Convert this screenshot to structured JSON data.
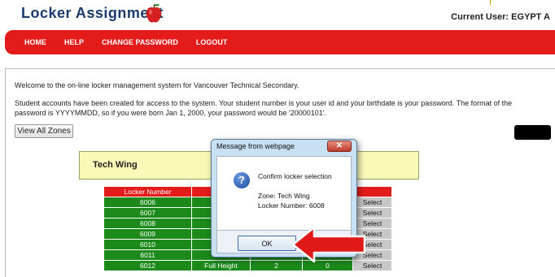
{
  "header": {
    "app_title": "Locker Assignment",
    "current_user": "Current User: EGYPT A"
  },
  "nav": {
    "items": [
      "HOME",
      "HELP",
      "CHANGE PASSWORD",
      "LOGOUT"
    ]
  },
  "content": {
    "welcome": "Welcome to the on-line locker management system for Vancouver Technical Secondary.",
    "accounts_info": "Student accounts have been created for access to the system. Your student number is your user id and your birthdate is your password. The format of the password is YYYYMMDD, so if you were born Jan 1, 2000, your password would be '20000101'.",
    "view_all_zones_label": "View All Zones"
  },
  "zone": {
    "name": "Tech Wing"
  },
  "table": {
    "header_locker_number": "Locker Number",
    "rows": [
      {
        "number": "6006",
        "type": "Fu",
        "col_a": "",
        "col_b": "",
        "select": "Select"
      },
      {
        "number": "6007",
        "type": "Fu",
        "col_a": "",
        "col_b": "",
        "select": "Select"
      },
      {
        "number": "6008",
        "type": "Fu",
        "col_a": "",
        "col_b": "",
        "select": "Select"
      },
      {
        "number": "6009",
        "type": "Fu",
        "col_a": "",
        "col_b": "",
        "select": "Select"
      },
      {
        "number": "6010",
        "type": "Fu",
        "col_a": "",
        "col_b": "",
        "select": "Select"
      },
      {
        "number": "6011",
        "type": "Fu",
        "col_a": "",
        "col_b": "",
        "select": "Select"
      },
      {
        "number": "6012",
        "type": "Full Height",
        "col_a": "2",
        "col_b": "0",
        "select": "Select"
      }
    ]
  },
  "dialog": {
    "title": "Message from webpage",
    "close_glyph": "✕",
    "message": "Confirm locker selection",
    "zone_line": "Zone: Tech Wing",
    "locker_line": "Locker Number: 6008",
    "ok_label": "OK",
    "icon": "question-icon"
  },
  "colors": {
    "nav_red": "#e31b1b",
    "title_blue": "#1a3a6b",
    "row_green": "#1b8a1b",
    "zone_yellow": "#fafab8",
    "arrow_red": "#e01818"
  }
}
